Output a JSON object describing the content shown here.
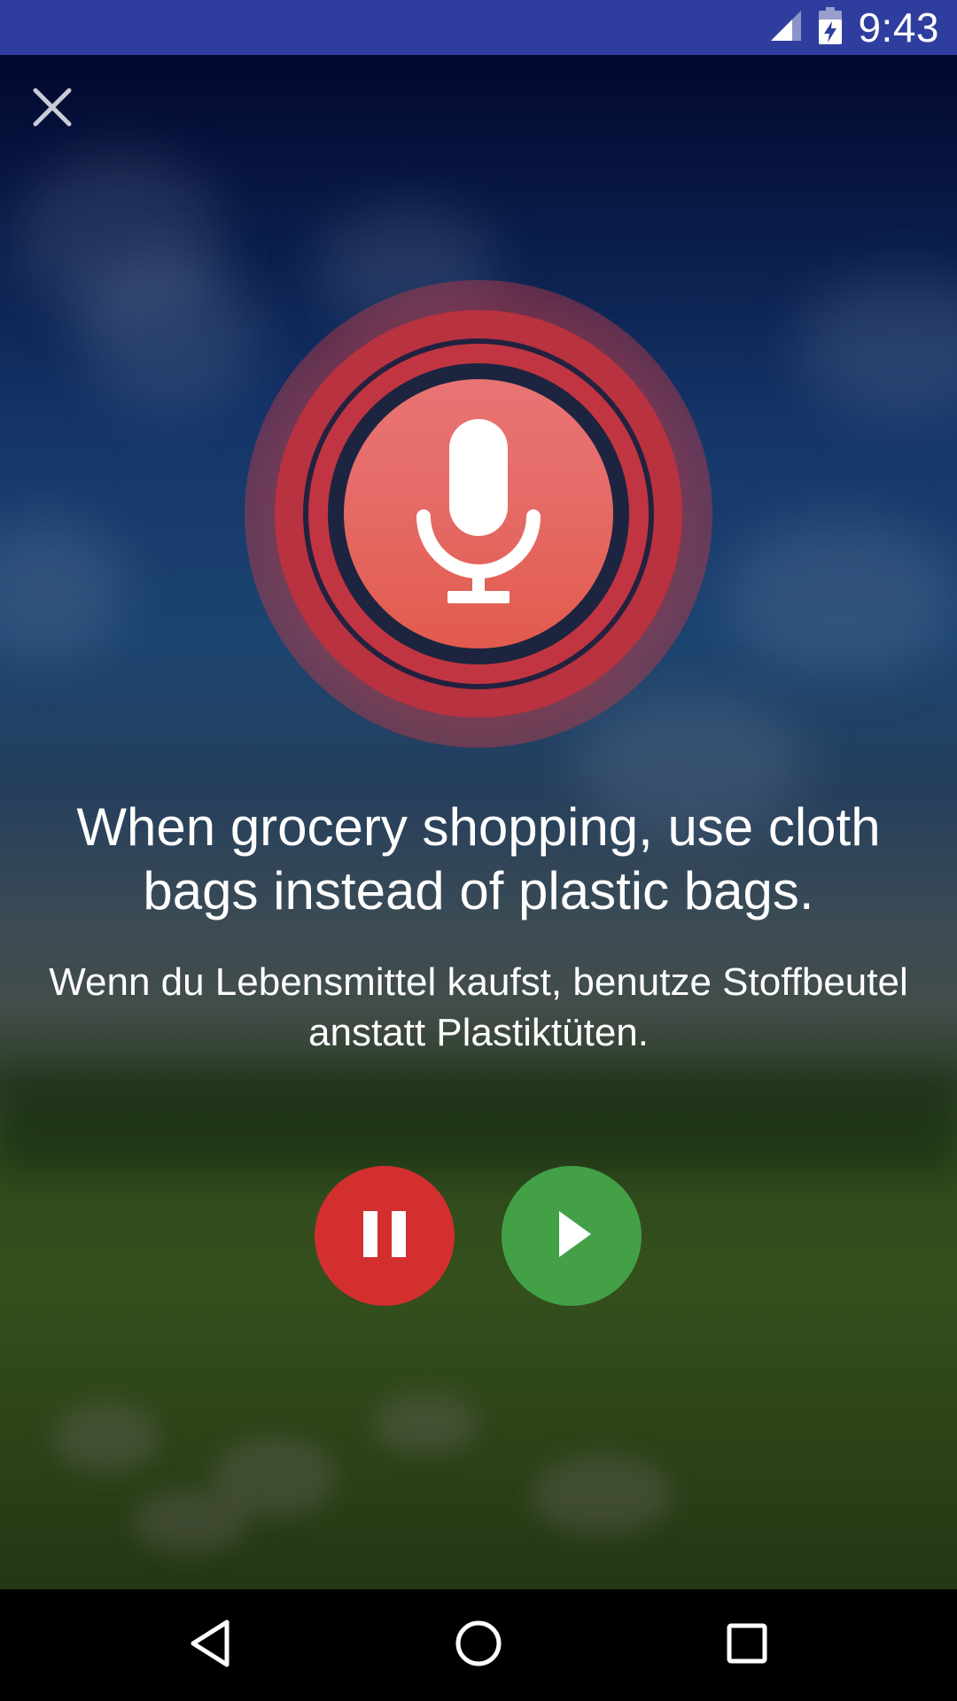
{
  "status_bar": {
    "time": "9:43",
    "icons": [
      "signal-icon",
      "battery-charging-icon"
    ],
    "background_color": "#2f3e9e"
  },
  "close_button": {
    "icon": "close-icon"
  },
  "microphone": {
    "icon": "microphone-icon",
    "state": "recording",
    "accent_color": "#e25b4d"
  },
  "sentence": {
    "english": "When grocery shopping, use cloth bags instead of plastic bags.",
    "german": "Wenn du Lebensmittel kaufst, benutze Stoffbeutel anstatt Plastiktüten."
  },
  "controls": {
    "pause": {
      "icon": "pause-icon",
      "color": "#d32f2f"
    },
    "play": {
      "icon": "play-icon",
      "color": "#43a047"
    }
  },
  "nav_bar": {
    "back": {
      "icon": "back-triangle-icon"
    },
    "home": {
      "icon": "home-circle-icon"
    },
    "recents": {
      "icon": "recents-square-icon"
    }
  }
}
